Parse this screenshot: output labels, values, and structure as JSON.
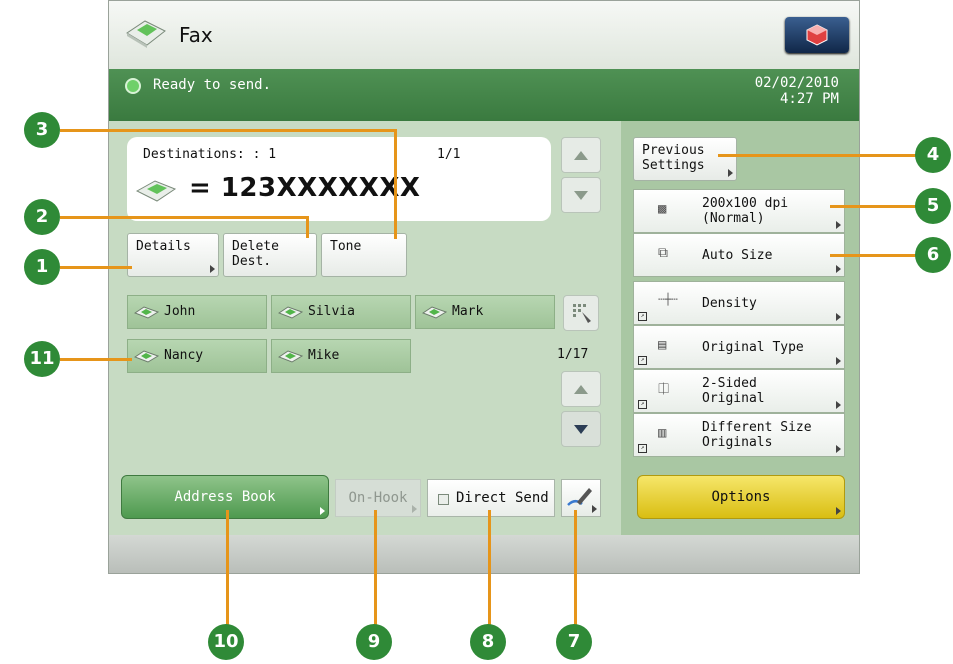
{
  "window": {
    "title": "Fax"
  },
  "status": {
    "message": "Ready to send.",
    "date": "02/02/2010",
    "time": "4:27 PM"
  },
  "destinations": {
    "label": "Destinations:  : 1",
    "page": "1/1",
    "value": "= 123XXXXXXX"
  },
  "buttons": {
    "details": "Details",
    "delete_dest_line1": "Delete",
    "delete_dest_line2": "Dest.",
    "tone": "Tone",
    "address_book": "Address Book",
    "on_hook": "On-Hook",
    "direct_send": "Direct Send",
    "options": "Options",
    "previous_settings_line1": "Previous",
    "previous_settings_line2": "Settings"
  },
  "addresses": {
    "items": [
      "John",
      "Silvia",
      "Mark",
      "Nancy",
      "Mike"
    ],
    "page": "1/17"
  },
  "settings": {
    "resolution_line1": "200x100 dpi",
    "resolution_line2": "(Normal)",
    "size": "Auto Size",
    "density": "Density",
    "original_type": "Original Type",
    "two_sided_line1": "2-Sided",
    "two_sided_line2": "Original",
    "diff_size_line1": "Different Size",
    "diff_size_line2": "Originals"
  },
  "callouts": [
    "1",
    "2",
    "3",
    "4",
    "5",
    "6",
    "7",
    "8",
    "9",
    "10",
    "11"
  ],
  "colors": {
    "callout": "#2f8a37",
    "leader": "#e6951a",
    "status_bar": "#3f8244",
    "options": "#e3cb2a"
  }
}
